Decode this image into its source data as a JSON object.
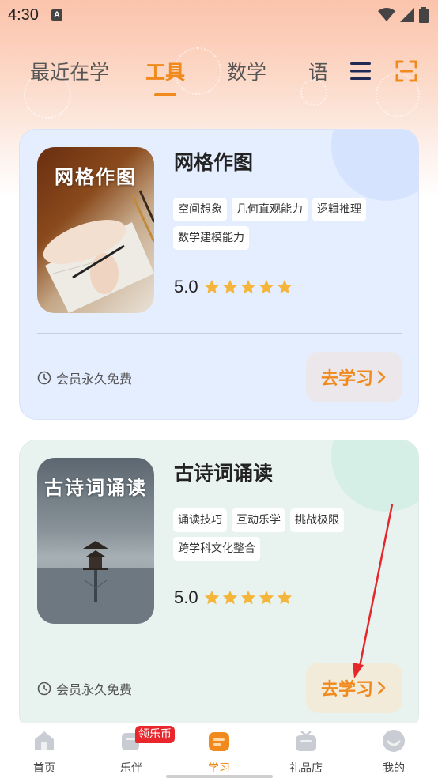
{
  "status_bar": {
    "time": "4:30",
    "notification_icon": "A"
  },
  "tabs": [
    {
      "label": "最近在学",
      "active": false
    },
    {
      "label": "工具",
      "active": true
    },
    {
      "label": "数学",
      "active": false
    },
    {
      "label": "语",
      "active": false
    }
  ],
  "icons": {
    "menu": "menu-icon",
    "scan": "scan-icon"
  },
  "colors": {
    "accent": "#f08a1c",
    "star": "#f5b53a",
    "badge": "#e8262b",
    "arrow": "#e5262b"
  },
  "cards": [
    {
      "thumb_title": "网格作图",
      "title": "网格作图",
      "tags": [
        "空间想象",
        "几何直观能力",
        "逻辑推理",
        "数学建模能力"
      ],
      "rating": "5.0",
      "stars": 5,
      "member_text": "会员永久免费",
      "button_label": "去学习"
    },
    {
      "thumb_title": "古诗词诵读",
      "title": "古诗词诵读",
      "tags": [
        "诵读技巧",
        "互动乐学",
        "挑战极限",
        "跨学科文化整合"
      ],
      "rating": "5.0",
      "stars": 5,
      "member_text": "会员永久免费",
      "button_label": "去学习"
    }
  ],
  "bottom_nav": {
    "items": [
      {
        "label": "首页",
        "icon": "home-icon"
      },
      {
        "label": "乐伴",
        "icon": "companion-icon"
      },
      {
        "label": "学习",
        "icon": "study-icon",
        "active": true
      },
      {
        "label": "礼品店",
        "icon": "gift-shop-icon"
      },
      {
        "label": "我的",
        "icon": "profile-icon"
      }
    ],
    "badge": "领乐币"
  }
}
